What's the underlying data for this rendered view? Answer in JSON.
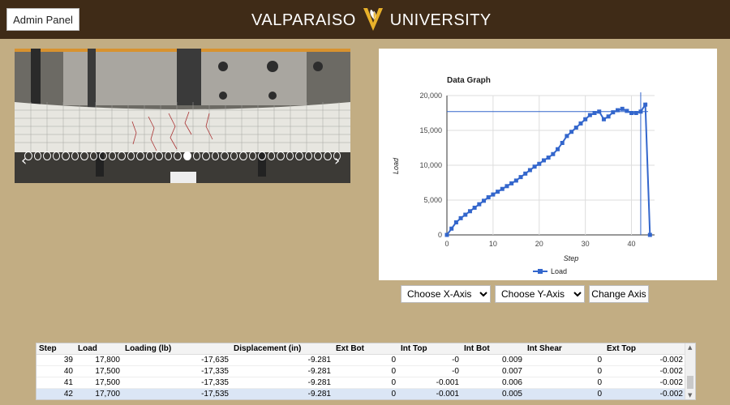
{
  "header": {
    "admin_label": "Admin Panel",
    "brand_left": "VALPARAISO",
    "brand_right": "UNIVERSITY",
    "colors": {
      "bar": "#3f2b17",
      "logo": "#e8b12a"
    }
  },
  "carousel": {
    "prev_icon": "‹",
    "next_icon": "›",
    "dot_count": 34,
    "active_dot": 17
  },
  "chart_data": {
    "type": "line",
    "title": "Data Graph",
    "xlabel": "Step",
    "ylabel": "Load",
    "xlim": [
      0,
      45
    ],
    "ylim": [
      0,
      20000
    ],
    "xticks": [
      "0",
      "10",
      "20",
      "30",
      "40"
    ],
    "yticks": [
      "0",
      "5,000",
      "10,000",
      "15,000",
      "20,000"
    ],
    "legend_position": "bottom",
    "series": [
      {
        "name": "Load",
        "color": "#3366cc",
        "x": [
          0,
          1,
          2,
          3,
          4,
          5,
          6,
          7,
          8,
          9,
          10,
          11,
          12,
          13,
          14,
          15,
          16,
          17,
          18,
          19,
          20,
          21,
          22,
          23,
          24,
          25,
          26,
          27,
          28,
          29,
          30,
          31,
          32,
          33,
          34,
          35,
          36,
          37,
          38,
          39,
          40,
          41,
          42,
          43,
          44
        ],
        "y": [
          0,
          900,
          1800,
          2400,
          2900,
          3400,
          3900,
          4400,
          4900,
          5400,
          5800,
          6200,
          6600,
          7000,
          7400,
          7800,
          8300,
          8800,
          9300,
          9800,
          10200,
          10700,
          11100,
          11600,
          12300,
          13200,
          14200,
          14800,
          15400,
          16000,
          16600,
          17200,
          17500,
          17700,
          16600,
          17000,
          17600,
          17900,
          18100,
          17800,
          17500,
          17500,
          17700,
          18700,
          0
        ]
      }
    ],
    "crosshair": {
      "x": 42,
      "y": 17700
    }
  },
  "controls": {
    "x_axis_label": "Choose X-Axis",
    "y_axis_label": "Choose Y-Axis",
    "change_label": "Change Axis"
  },
  "table": {
    "headers": [
      "Step",
      "Load",
      "Loading (lb)",
      "Displacement (in)",
      "Ext Bot",
      "Int Top",
      "Int Bot",
      "Int Shear",
      "Ext Top"
    ],
    "rows": [
      [
        "39",
        "17,800",
        "-17,635",
        "-9.281",
        "0",
        "-0",
        "0.009",
        "0",
        "-0.002"
      ],
      [
        "40",
        "17,500",
        "-17,335",
        "-9.281",
        "0",
        "-0",
        "0.007",
        "0",
        "-0.002"
      ],
      [
        "41",
        "17,500",
        "-17,335",
        "-9.281",
        "0",
        "-0.001",
        "0.006",
        "0",
        "-0.002"
      ],
      [
        "42",
        "17,700",
        "-17,535",
        "-9.281",
        "0",
        "-0.001",
        "0.005",
        "0",
        "-0.002"
      ]
    ],
    "selected_row": 3
  }
}
